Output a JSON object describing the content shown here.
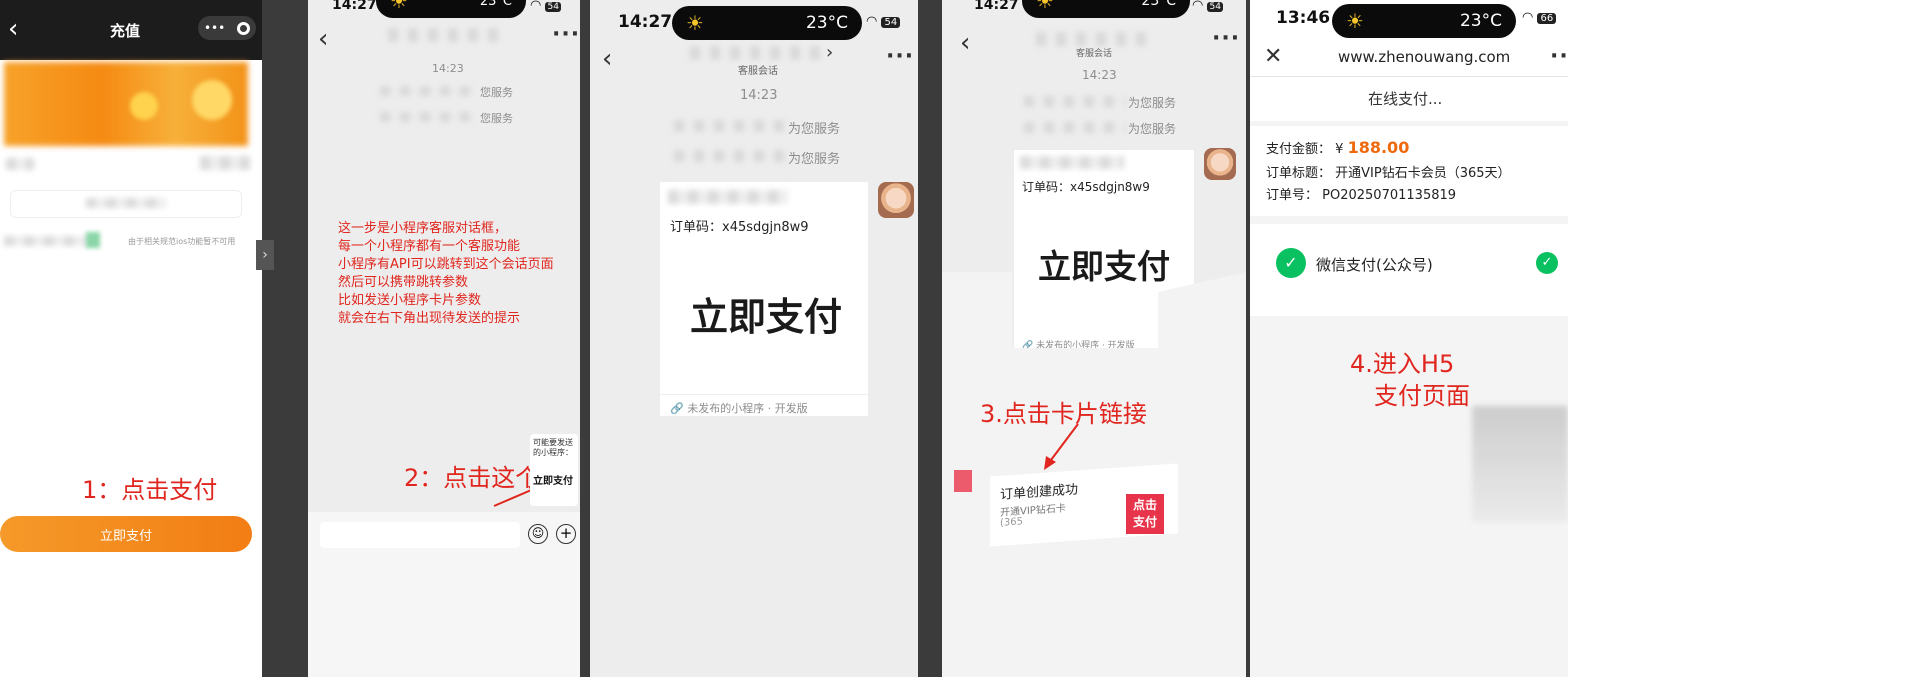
{
  "panel1": {
    "title": "充值",
    "notice": "由于相关规范ios功能暂不可用",
    "step_label": "1：点击支付",
    "pay_button": "立即支付"
  },
  "panel2": {
    "time": "14:27",
    "weather": "23°C",
    "battery": "54",
    "timestamp": "14:23",
    "service_lines": [
      "您服务",
      "您服务"
    ],
    "annotation_lines": [
      "这一步是小程序客服对话框，",
      "每一个小程序都有一个客服功能",
      "小程序有API可以跳转到这个会话页面",
      "然后可以携带跳转参数",
      "比如发送小程序卡片参数",
      "就会在右下角出现待发送的提示"
    ],
    "hint_title": "可能要发送的小程序：",
    "hint_pay": "立即支付",
    "step_label": "2：点击这个"
  },
  "panel3": {
    "time": "14:27",
    "weather": "23°C",
    "battery": "54",
    "subtitle": "客服会话",
    "timestamp": "14:23",
    "service_lines": [
      "为您服务",
      "为您服务"
    ],
    "order_code": "订单码：x45sdgjn8w9",
    "pay_text": "立即支付",
    "source": "未发布的小程序 · 开发版"
  },
  "panel4": {
    "time": "14:27",
    "weather": "23°C",
    "battery": "54",
    "subtitle": "客服会话",
    "timestamp": "14:23",
    "service_lines": [
      "为您服务",
      "为您服务"
    ],
    "order_code": "订单码：x45sdgjn8w9",
    "pay_text": "立即支付",
    "source": "未发布的小程序 · 开发版",
    "step_label": "3.点击卡片链接",
    "notif_title": "订单创建成功",
    "notif_line1": "开通VIP钻石卡",
    "notif_line2": "(365",
    "notif_button_line1": "点击",
    "notif_button_line2": "支付"
  },
  "panel5": {
    "time": "13:46",
    "weather": "23°C",
    "battery": "66",
    "url": "www.zhenouwang.com",
    "page_title": "在线支付...",
    "amount_label": "支付金额：",
    "amount_currency": "¥",
    "amount_value": "188.00",
    "order_title_label": "订单标题：",
    "order_title_value": "开通VIP钻石卡会员（365天）",
    "order_no_label": "订单号：",
    "order_no_value": "PO20250701135819",
    "method_label": "微信支付(公众号)",
    "step_line1": "4.进入H5",
    "step_line2": "支付页面"
  },
  "colors": {
    "accent_orange": "#f28a1e",
    "annotation_red": "#e0261e",
    "wechat_green": "#09c160",
    "amount_orange": "#ee6a0d",
    "notify_red": "#e8344a"
  }
}
